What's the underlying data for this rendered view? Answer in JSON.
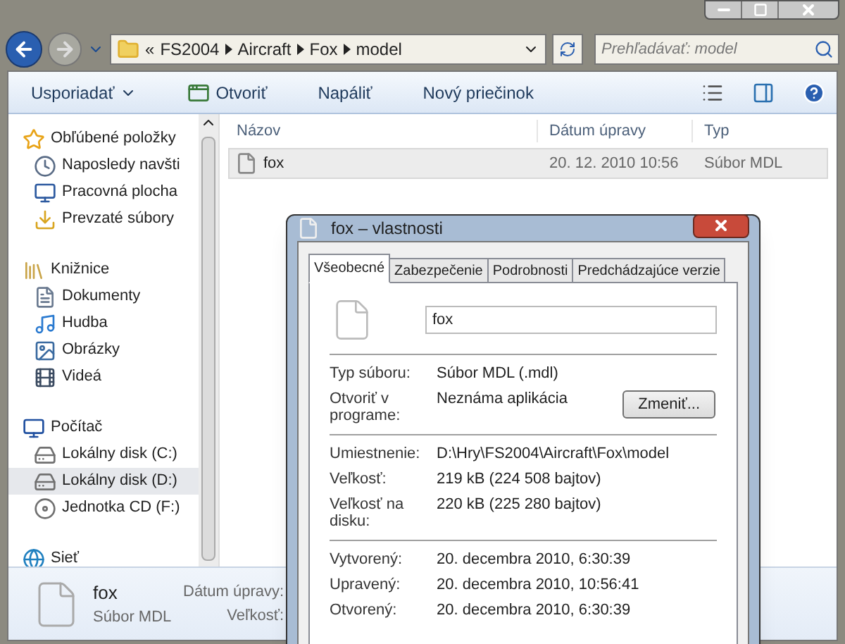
{
  "address_bar": {
    "path": [
      "«",
      "FS2004",
      "Aircraft",
      "Fox",
      "model"
    ]
  },
  "search": {
    "placeholder": "Prehľadávať: model"
  },
  "toolbar": {
    "buttons": [
      {
        "label": "Usporiadať",
        "kind": "menu"
      },
      {
        "label": "Otvoriť",
        "kind": "open"
      },
      {
        "label": "Napáliť",
        "kind": "plain"
      },
      {
        "label": "Nový priečinok",
        "kind": "plain"
      }
    ]
  },
  "sidebar": {
    "groups": [
      {
        "label": "Obľúbené položky",
        "kind": "favorites",
        "items": [
          {
            "label": "Naposledy navšti",
            "kind": "recent",
            "selected": false
          },
          {
            "label": "Pracovná plocha",
            "kind": "desktop",
            "selected": false
          },
          {
            "label": "Prevzaté súbory",
            "kind": "downloads",
            "selected": false
          }
        ]
      },
      {
        "label": "Knižnice",
        "kind": "libraries",
        "items": [
          {
            "label": "Dokumenty",
            "kind": "documents",
            "selected": false
          },
          {
            "label": "Hudba",
            "kind": "music",
            "selected": false
          },
          {
            "label": "Obrázky",
            "kind": "pictures",
            "selected": false
          },
          {
            "label": "Videá",
            "kind": "videos",
            "selected": false
          }
        ]
      },
      {
        "label": "Počítač",
        "kind": "computer",
        "items": [
          {
            "label": "Lokálny disk (C:)",
            "kind": "disk",
            "selected": false
          },
          {
            "label": "Lokálny disk (D:)",
            "kind": "disk",
            "selected": true
          },
          {
            "label": "Jednotka CD (F:)",
            "kind": "cd",
            "selected": false
          }
        ]
      },
      {
        "label": "Sieť",
        "kind": "network"
      }
    ]
  },
  "file_list": {
    "columns": [
      "Názov",
      "Dátum úpravy",
      "Typ"
    ],
    "rows": [
      {
        "cells": [
          "fox",
          "20. 12. 2010 10:56",
          "Súbor MDL"
        ],
        "selected": true
      }
    ]
  },
  "details_pane": {
    "name": "fox",
    "type": "Súbor MDL",
    "labels": [
      "Dátum úpravy:",
      "Veľkosť:"
    ]
  },
  "dialog": {
    "title": "fox – vlastnosti",
    "tabs": [
      {
        "label": "Všeobecné",
        "selected": true
      },
      {
        "label": "Zabezpečenie",
        "selected": false
      },
      {
        "label": "Podrobnosti",
        "selected": false
      },
      {
        "label": "Predchádzajúce verzie",
        "selected": false
      }
    ],
    "file_name": "fox",
    "sections": [
      [
        {
          "label": "Typ súboru:",
          "value": "Súbor MDL (.mdl)"
        },
        {
          "label": "Otvoriť v programe:",
          "value": "Neznáma aplikácia",
          "button": "Zmeniť..."
        }
      ],
      [
        {
          "label": "Umiestnenie:",
          "value": "D:\\Hry\\FS2004\\Aircraft\\Fox\\model"
        },
        {
          "label": "Veľkosť:",
          "value": "219 kB (224 508 bajtov)"
        },
        {
          "label": "Veľkosť na disku:",
          "value": "220 kB (225 280 bajtov)"
        }
      ],
      [
        {
          "label": "Vytvorený:",
          "value": "20. decembra 2010, 6:30:39"
        },
        {
          "label": "Upravený:",
          "value": "20. decembra 2010, 10:56:41"
        },
        {
          "label": "Otvorený:",
          "value": "20. decembra 2010, 6:30:39"
        }
      ]
    ]
  }
}
